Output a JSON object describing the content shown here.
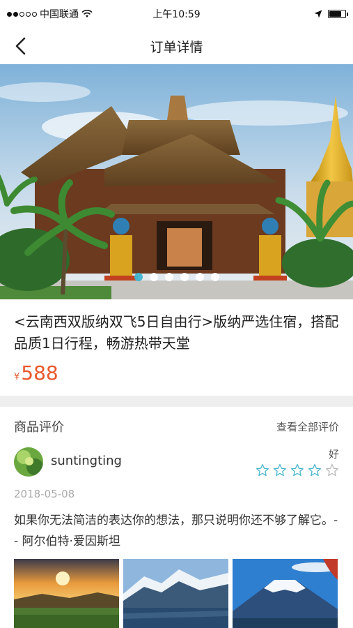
{
  "status_bar": {
    "carrier": "中国联通",
    "time": "上午10:59",
    "wifi_icon": "wifi-icon",
    "location_icon": "location-arrow-icon",
    "battery_level": 0.75
  },
  "nav": {
    "title": "订单详情",
    "back_icon": "chevron-left-icon"
  },
  "banner": {
    "slide_count": 6,
    "active_index": 0,
    "image": "thai-temple-photo"
  },
  "product": {
    "title": "<云南西双版纳双飞5日自由行>版纳严选住宿，搭配品质1日行程，畅游热带天堂",
    "currency": "¥",
    "price": "588"
  },
  "reviews": {
    "section_title": "商品评价",
    "view_all": "查看全部评价",
    "items": [
      {
        "user": "suntingting",
        "rating_label": "好",
        "stars_filled": 4,
        "stars_total": 5,
        "date": "2018-05-08",
        "text": "如果你无法简洁的表达你的想法，那只说明你还不够了解它。-- 阿尔伯特·爱因斯坦",
        "photos": [
          "sunset-lake-photo",
          "snowy-mountain-lake-photo",
          "mount-fuji-photo"
        ]
      }
    ]
  },
  "colors": {
    "price": "#e8582c",
    "star": "#4cb8cf",
    "pager_active": "#3fb4d1",
    "divider": "#eeeeee"
  }
}
